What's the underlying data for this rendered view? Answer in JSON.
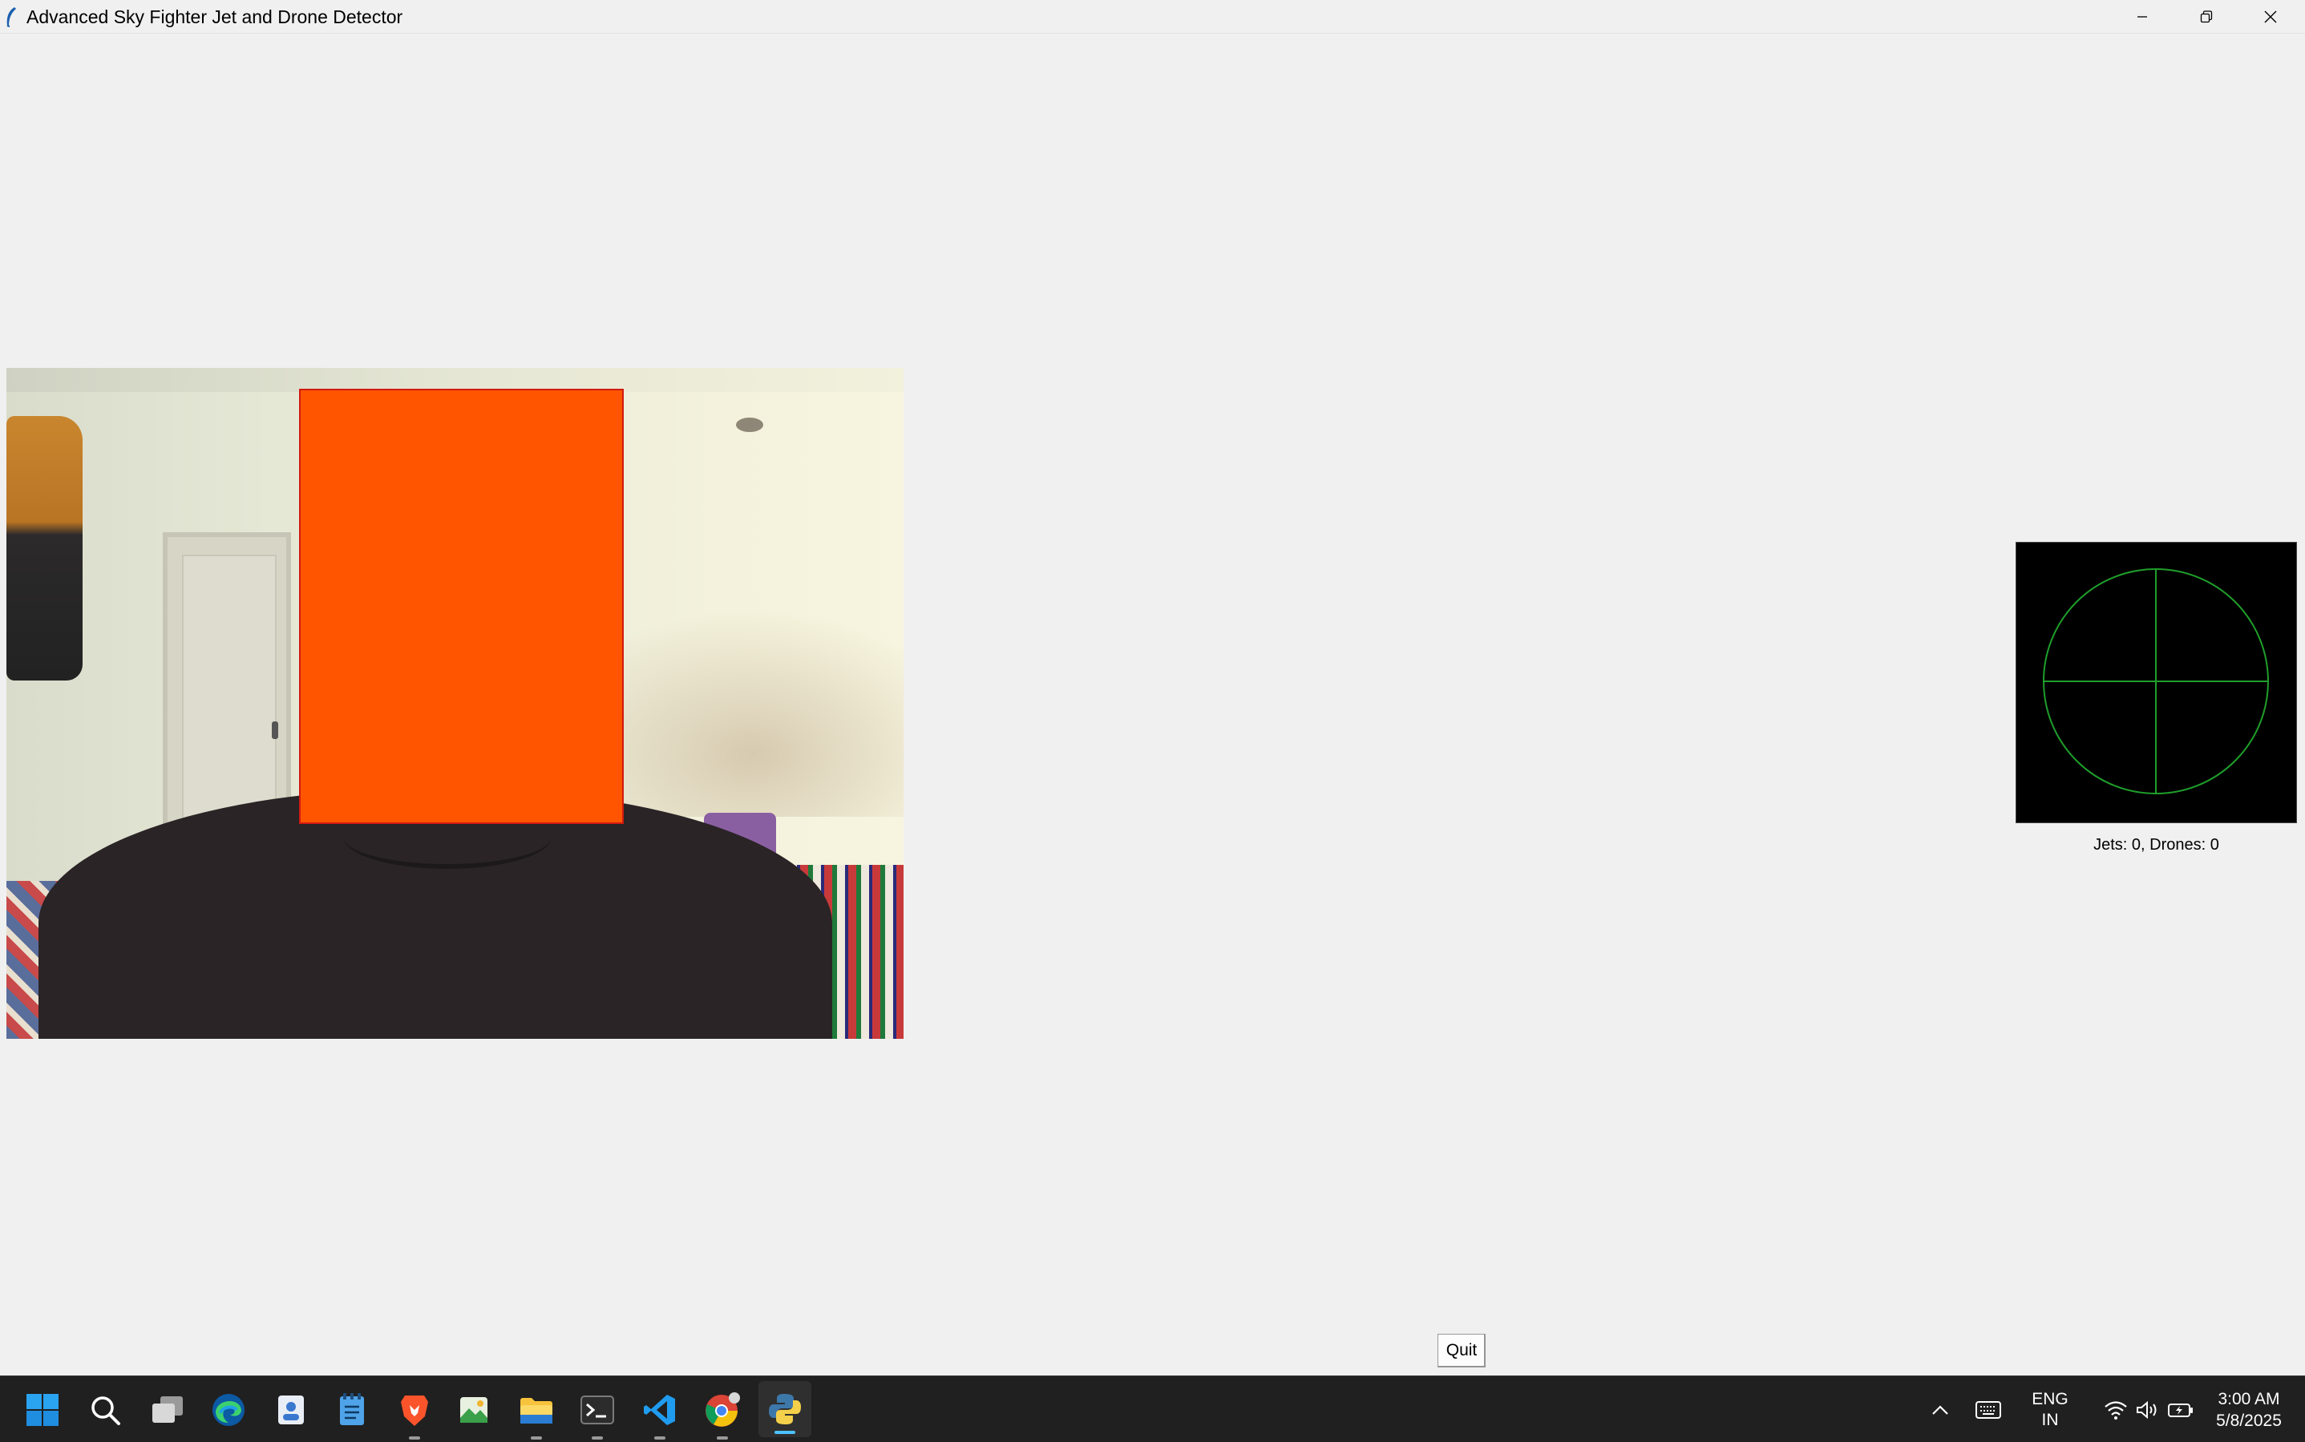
{
  "window": {
    "title": "Advanced Sky Fighter Jet and Drone Detector",
    "controls": {
      "minimize": "minimize",
      "maximize": "restore",
      "close": "close"
    }
  },
  "video_feed": {
    "description_icon": "camera-feed",
    "redaction_color": "#ff5500"
  },
  "radar": {
    "background": "#000000",
    "line_color": "#1f9e2b",
    "status_text": "Jets: 0, Drones: 0"
  },
  "controls": {
    "quit_label": "Quit"
  },
  "taskbar": {
    "apps": [
      {
        "name": "windows-start-icon"
      },
      {
        "name": "search-icon"
      },
      {
        "name": "task-view-icon"
      },
      {
        "name": "edge-icon"
      },
      {
        "name": "contacts-app-icon"
      },
      {
        "name": "notepad-icon"
      },
      {
        "name": "brave-browser-icon"
      },
      {
        "name": "photos-app-icon"
      },
      {
        "name": "file-explorer-icon"
      },
      {
        "name": "terminal-icon"
      },
      {
        "name": "vscode-icon"
      },
      {
        "name": "chrome-icon"
      },
      {
        "name": "python-app-icon"
      }
    ],
    "tray": {
      "language_line1": "ENG",
      "language_line2": "IN",
      "time": "3:00 AM",
      "date": "5/8/2025"
    }
  }
}
